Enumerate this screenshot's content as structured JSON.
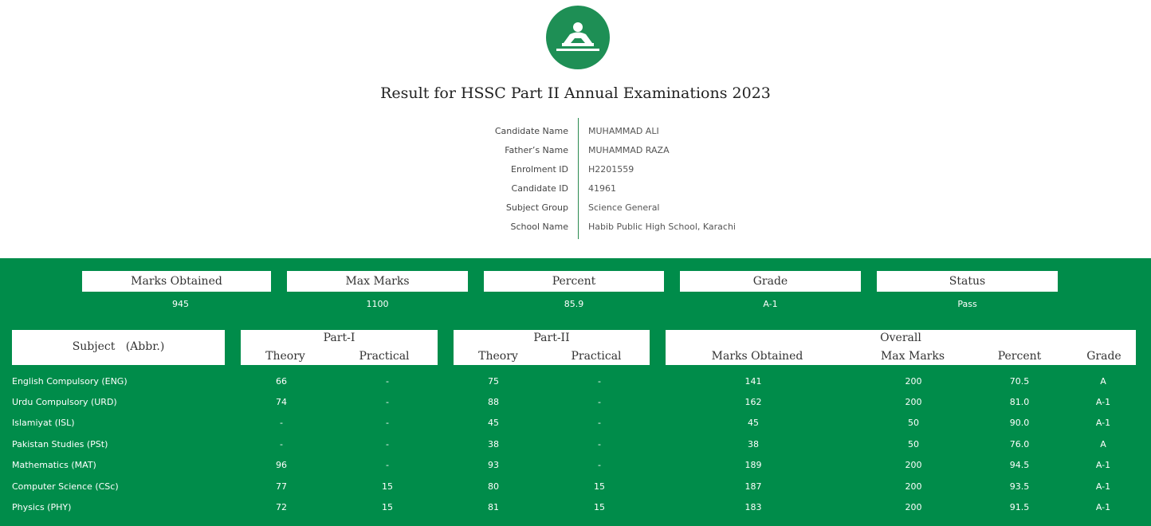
{
  "header": {
    "title": "Result for HSSC Part II Annual Examinations 2023",
    "logo_icon": "student-reading-icon"
  },
  "candidate": {
    "fields": [
      {
        "label": "Candidate Name",
        "value": "MUHAMMAD ALI"
      },
      {
        "label": "Father’s Name",
        "value": "MUHAMMAD RAZA"
      },
      {
        "label": "Enrolment ID",
        "value": "H2201559"
      },
      {
        "label": "Candidate ID",
        "value": "41961"
      },
      {
        "label": "Subject Group",
        "value": "Science General"
      },
      {
        "label": "School Name",
        "value": "Habib Public High School, Karachi"
      }
    ]
  },
  "summary": {
    "marks_obtained_label": "Marks Obtained",
    "marks_obtained": "945",
    "max_marks_label": "Max Marks",
    "max_marks": "1100",
    "percent_label": "Percent",
    "percent": "85.9",
    "grade_label": "Grade",
    "grade": "A-1",
    "status_label": "Status",
    "status": "Pass"
  },
  "table": {
    "subject_header": "Subject   (Abbr.)",
    "part1_header": "Part-I",
    "part2_header": "Part-II",
    "overall_header": "Overall",
    "theory": "Theory",
    "practical": "Practical",
    "marks_obtained": "Marks Obtained",
    "max_marks": "Max Marks",
    "percent": "Percent",
    "grade": "Grade",
    "rows": [
      {
        "subject": "English Compulsory  (ENG)",
        "p1t": "66",
        "p1p": "-",
        "p2t": "75",
        "p2p": "-",
        "obt": "141",
        "max": "200",
        "pct": "70.5",
        "grade": "A"
      },
      {
        "subject": "Urdu Compulsory  (URD)",
        "p1t": "74",
        "p1p": "-",
        "p2t": "88",
        "p2p": "-",
        "obt": "162",
        "max": "200",
        "pct": "81.0",
        "grade": "A-1"
      },
      {
        "subject": "Islamiyat  (ISL)",
        "p1t": "-",
        "p1p": "-",
        "p2t": "45",
        "p2p": "-",
        "obt": "45",
        "max": "50",
        "pct": "90.0",
        "grade": "A-1"
      },
      {
        "subject": "Pakistan Studies  (PSt)",
        "p1t": "-",
        "p1p": "-",
        "p2t": "38",
        "p2p": "-",
        "obt": "38",
        "max": "50",
        "pct": "76.0",
        "grade": "A"
      },
      {
        "subject": "Mathematics  (MAT)",
        "p1t": "96",
        "p1p": "-",
        "p2t": "93",
        "p2p": "-",
        "obt": "189",
        "max": "200",
        "pct": "94.5",
        "grade": "A-1"
      },
      {
        "subject": "Computer Science  (CSc)",
        "p1t": "77",
        "p1p": "15",
        "p2t": "80",
        "p2p": "15",
        "obt": "187",
        "max": "200",
        "pct": "93.5",
        "grade": "A-1"
      },
      {
        "subject": "Physics  (PHY)",
        "p1t": "72",
        "p1p": "15",
        "p2t": "81",
        "p2p": "15",
        "obt": "183",
        "max": "200",
        "pct": "91.5",
        "grade": "A-1"
      }
    ]
  },
  "colors": {
    "brand_green": "#008c4a",
    "logo_green": "#1e8f55"
  }
}
